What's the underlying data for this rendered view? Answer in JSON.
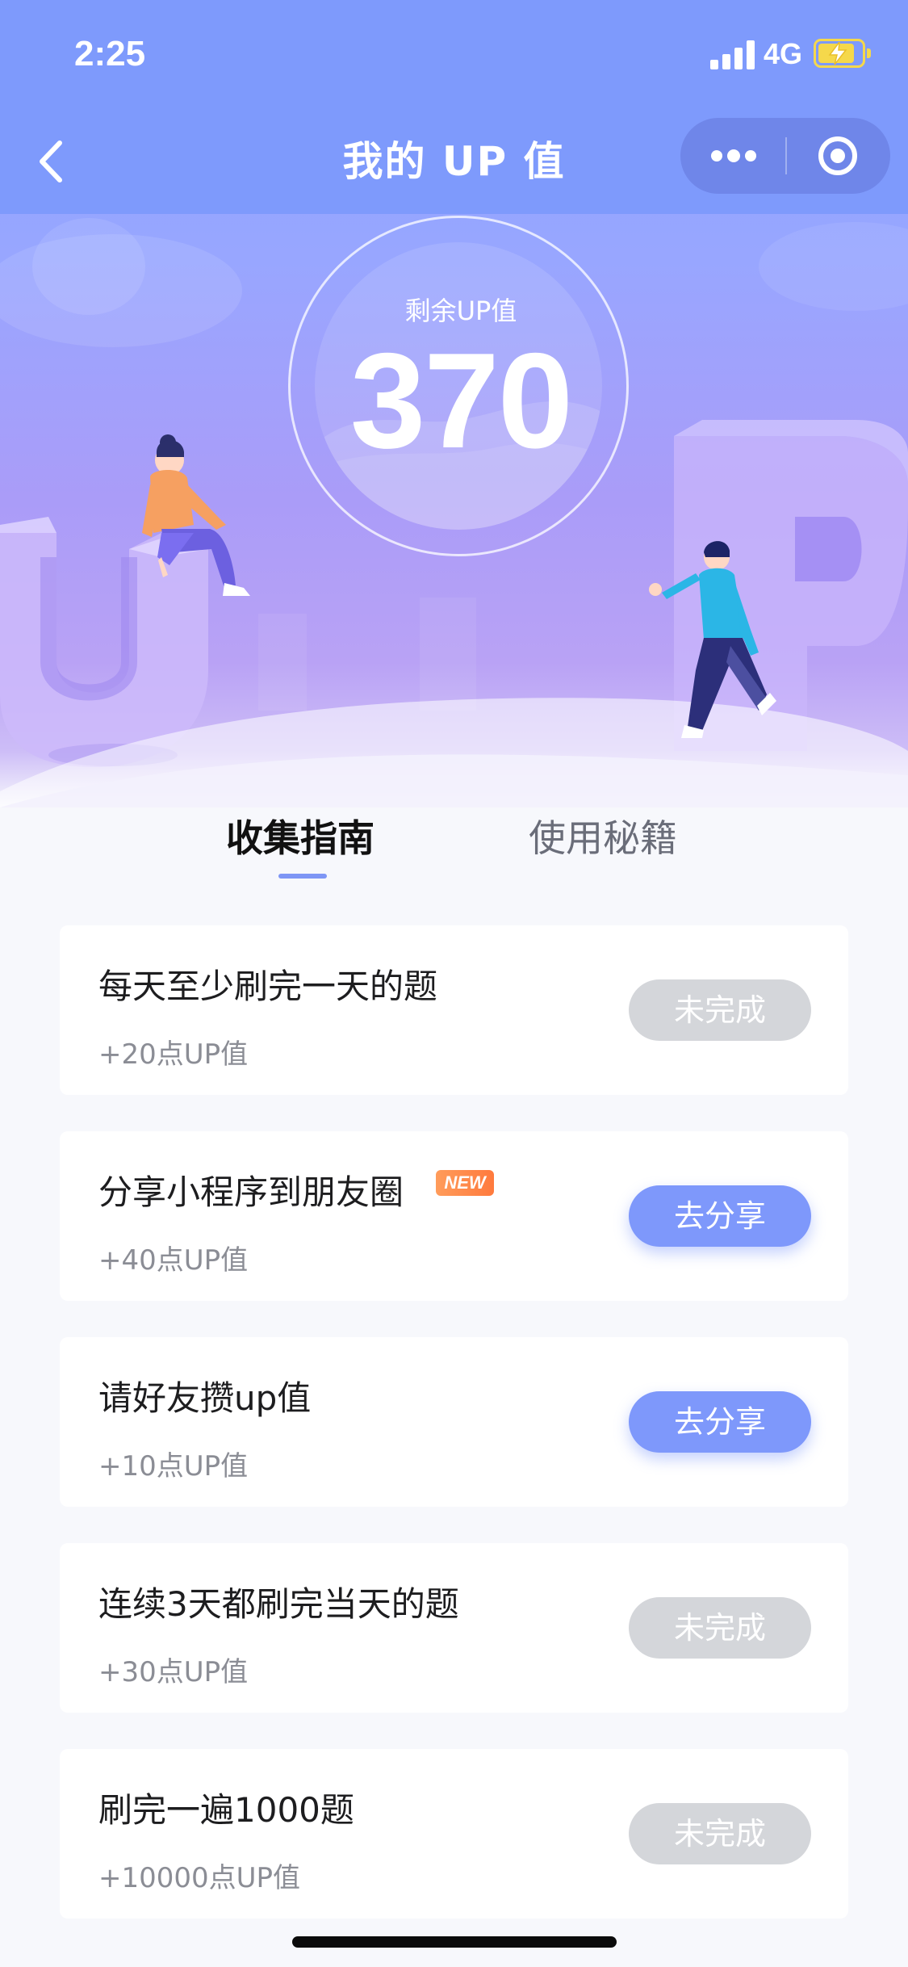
{
  "status_bar": {
    "time": "2:25",
    "network": "4G"
  },
  "nav": {
    "title": "我的 UP 值"
  },
  "score": {
    "label": "剩余UP值",
    "value": "370"
  },
  "tabs": [
    {
      "label": "收集指南",
      "active": true
    },
    {
      "label": "使用秘籍",
      "active": false
    }
  ],
  "tasks": [
    {
      "title": "每天至少刷完一天的题",
      "reward": "+20点UP值",
      "button": "未完成",
      "status": "incomplete"
    },
    {
      "title": "分享小程序到朋友圈",
      "badge": "NEW",
      "reward": "+40点UP值",
      "button": "去分享",
      "status": "share"
    },
    {
      "title": "请好友攒up值",
      "reward": "+10点UP值",
      "button": "去分享",
      "status": "share"
    },
    {
      "title": "连续3天都刷完当天的题",
      "reward": "+30点UP值",
      "button": "未完成",
      "status": "incomplete"
    },
    {
      "title": "刷完一遍1000题",
      "reward": "+10000点UP值",
      "button": "未完成",
      "status": "incomplete"
    }
  ],
  "colors": {
    "primary": "#7e98fb",
    "nav_background": "#7e9afc",
    "disabled_button": "#d4d6da",
    "badge": "#ff8a48"
  },
  "icons": [
    "back-chevron-icon",
    "signal-icon",
    "battery-charging-icon",
    "more-dots-icon",
    "close-target-icon"
  ]
}
